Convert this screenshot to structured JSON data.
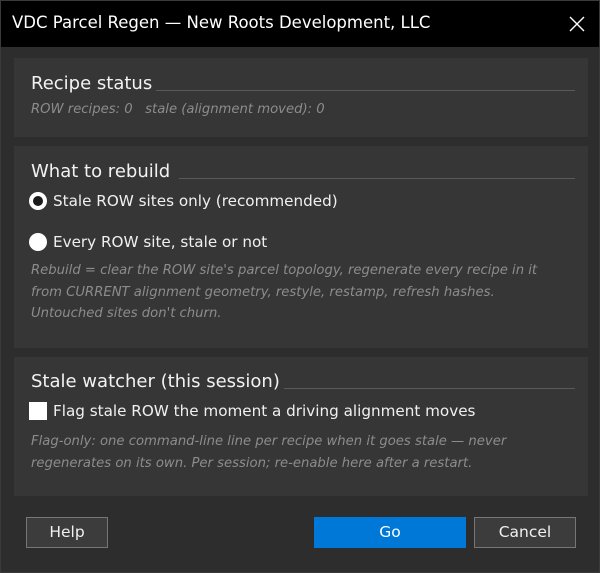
{
  "window": {
    "title": "VDC Parcel Regen — New Roots Development, LLC"
  },
  "recipe_status": {
    "title": "Recipe status",
    "summary": "ROW recipes: 0   stale (alignment moved): 0"
  },
  "rebuild": {
    "title": "What to rebuild",
    "options": [
      {
        "label": "Stale ROW sites only (recommended)",
        "selected": true
      },
      {
        "label": "Every ROW site, stale or not",
        "selected": false
      }
    ],
    "hint_lines": [
      "Rebuild = clear the ROW site's parcel topology, regenerate every recipe in it",
      "from CURRENT alignment geometry, restyle, restamp, refresh hashes.",
      "Untouched sites don't churn."
    ]
  },
  "watcher": {
    "title": "Stale watcher (this session)",
    "checkbox_label": "Flag stale ROW the moment a driving alignment moves",
    "checked": false,
    "hint_lines": [
      "Flag-only: one command-line line per recipe when it goes stale — never",
      "regenerates on its own. Per session; re-enable here after a restart."
    ]
  },
  "buttons": {
    "help": "Help",
    "go": "Go",
    "cancel": "Cancel"
  },
  "colors": {
    "titlebar": "#000000",
    "background": "#2d2d2d",
    "group": "#363636",
    "accent": "#0078d7",
    "hint_text": "#8c8c8c"
  }
}
